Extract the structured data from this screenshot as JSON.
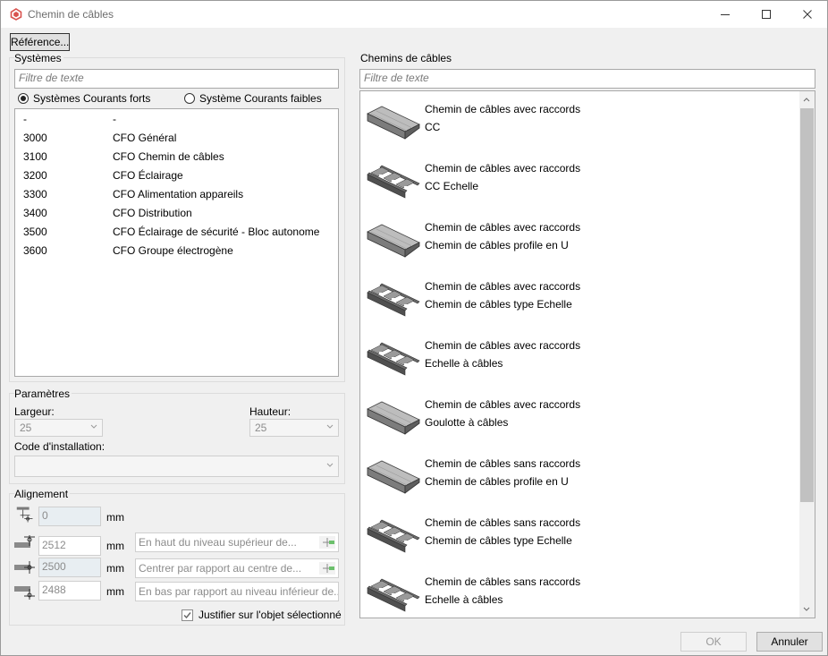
{
  "window": {
    "title": "Chemin de câbles"
  },
  "toolbar": {
    "reference_label": "Référence..."
  },
  "systems": {
    "group_label": "Systèmes",
    "filter_placeholder": "Filtre de texte",
    "radio_strong": "Systèmes Courants forts",
    "radio_weak": "Système Courants faibles",
    "rows": [
      {
        "code": "-",
        "name": "-"
      },
      {
        "code": "3000",
        "name": "CFO Général"
      },
      {
        "code": "3100",
        "name": "CFO Chemin de câbles"
      },
      {
        "code": "3200",
        "name": "CFO Éclairage"
      },
      {
        "code": "3300",
        "name": "CFO Alimentation appareils"
      },
      {
        "code": "3400",
        "name": "CFO Distribution"
      },
      {
        "code": "3500",
        "name": "CFO Éclairage de sécurité - Bloc autonome"
      },
      {
        "code": "3600",
        "name": "CFO Groupe électrogène"
      }
    ]
  },
  "params": {
    "group_label": "Paramètres",
    "width_label": "Largeur:",
    "width_value": "25",
    "height_label": "Hauteur:",
    "height_value": "25",
    "install_code_label": "Code d'installation:",
    "install_code_value": ""
  },
  "alignment": {
    "group_label": "Alignement",
    "unit": "mm",
    "offset_value": "0",
    "top_value": "2512",
    "top_ref": "En haut du niveau supérieur de...",
    "center_value": "2500",
    "center_ref": "Centrer par rapport au centre de...",
    "bottom_value": "2488",
    "bottom_ref": "En bas par rapport au niveau inférieur de...",
    "justify_label": "Justifier sur l'objet sélectionné"
  },
  "cable_trays": {
    "group_label": "Chemins de câbles",
    "filter_placeholder": "Filtre de texte",
    "items": [
      {
        "line1": "Chemin de câbles avec raccords",
        "line2": "CC",
        "icon": "solid-tray-icon"
      },
      {
        "line1": "Chemin de câbles avec raccords",
        "line2": "CC Echelle",
        "icon": "ladder-tray-icon"
      },
      {
        "line1": "Chemin de câbles avec raccords",
        "line2": "Chemin de câbles profile en U",
        "icon": "solid-tray-icon"
      },
      {
        "line1": "Chemin de câbles avec raccords",
        "line2": "Chemin de câbles type Echelle",
        "icon": "ladder-tray-icon"
      },
      {
        "line1": "Chemin de câbles avec raccords",
        "line2": "Echelle à câbles",
        "icon": "ladder-tray-icon"
      },
      {
        "line1": "Chemin de câbles avec raccords",
        "line2": "Goulotte à câbles",
        "icon": "solid-tray-icon"
      },
      {
        "line1": "Chemin de câbles sans raccords",
        "line2": "Chemin de câbles profile en U",
        "icon": "solid-tray-icon"
      },
      {
        "line1": "Chemin de câbles sans raccords",
        "line2": "Chemin de câbles type Echelle",
        "icon": "ladder-tray-icon"
      },
      {
        "line1": "Chemin de câbles sans raccords",
        "line2": "Echelle à câbles",
        "icon": "ladder-tray-icon"
      }
    ]
  },
  "footer": {
    "ok_label": "OK",
    "cancel_label": "Annuler"
  },
  "colors": {
    "window_bg": "#f0f0f0",
    "app_icon": "#d9534f",
    "scroll_thumb": "#c1c1c1"
  }
}
